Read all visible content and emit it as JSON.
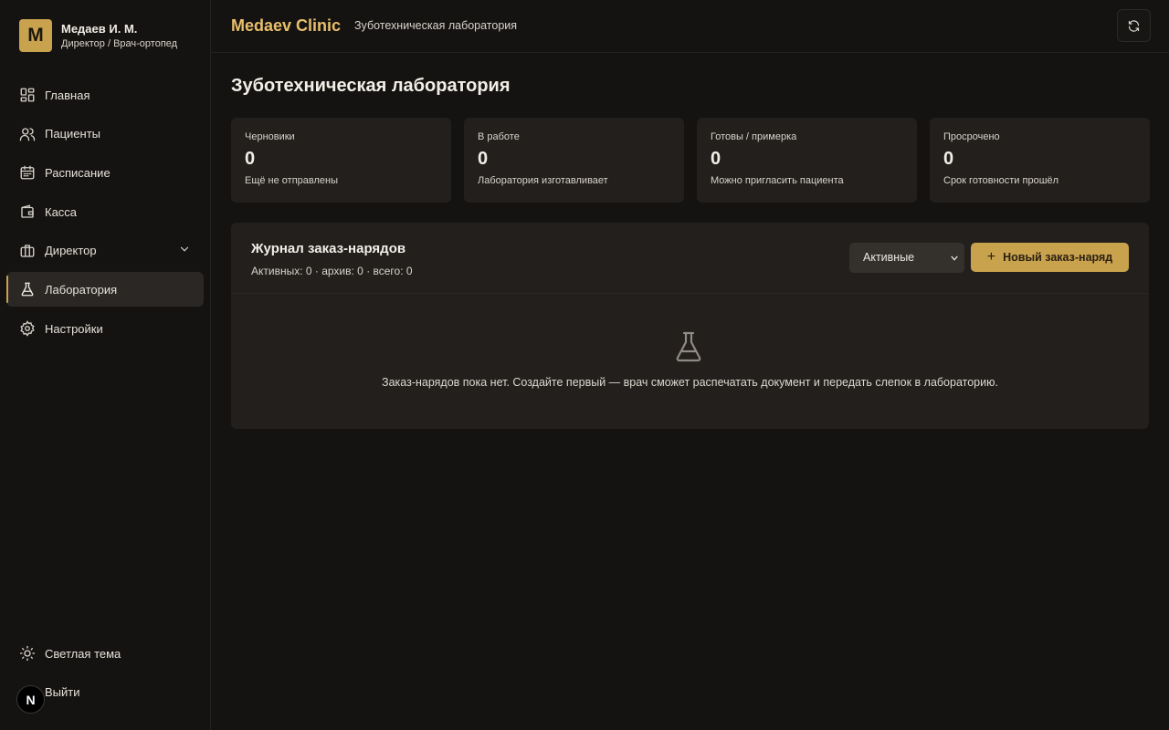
{
  "user": {
    "initial": "М",
    "name": "Медаев И. М.",
    "role": "Директор / Врач-ортопед"
  },
  "nav": {
    "items": [
      {
        "label": "Главная",
        "icon": "dashboard-icon"
      },
      {
        "label": "Пациенты",
        "icon": "users-icon"
      },
      {
        "label": "Расписание",
        "icon": "calendar-icon"
      },
      {
        "label": "Касса",
        "icon": "wallet-icon"
      },
      {
        "label": "Директор",
        "icon": "briefcase-icon"
      },
      {
        "label": "Лаборатория",
        "icon": "flask-icon",
        "active": true
      },
      {
        "label": "Настройки",
        "icon": "gear-icon"
      }
    ],
    "theme_label": "Светлая тема",
    "logout_label": "Выйти",
    "badge": "N"
  },
  "header": {
    "brand": "Medaev Clinic",
    "breadcrumb": "Зуботехническая лаборатория"
  },
  "page": {
    "title": "Зуботехническая лаборатория"
  },
  "stats": [
    {
      "label": "Черновики",
      "value": "0",
      "sub": "Ещё не отправлены"
    },
    {
      "label": "В работе",
      "value": "0",
      "sub": "Лаборатория изготавливает"
    },
    {
      "label": "Готовы / примерка",
      "value": "0",
      "sub": "Можно пригласить пациента"
    },
    {
      "label": "Просрочено",
      "value": "0",
      "sub": "Срок готовности прошёл"
    }
  ],
  "journal": {
    "title": "Журнал заказ-нарядов",
    "counts": "Активных: 0 · архив: 0 · всего: 0",
    "filter_value": "Активные",
    "new_button": "Новый заказ-наряд",
    "empty_text": "Заказ-нарядов пока нет. Создайте первый — врач сможет распечатать документ и передать слепок в лабораторию."
  },
  "colors": {
    "accent": "#c9a24e",
    "brand": "#e8bf6b",
    "background": "#151311",
    "card": "#221f1c"
  }
}
